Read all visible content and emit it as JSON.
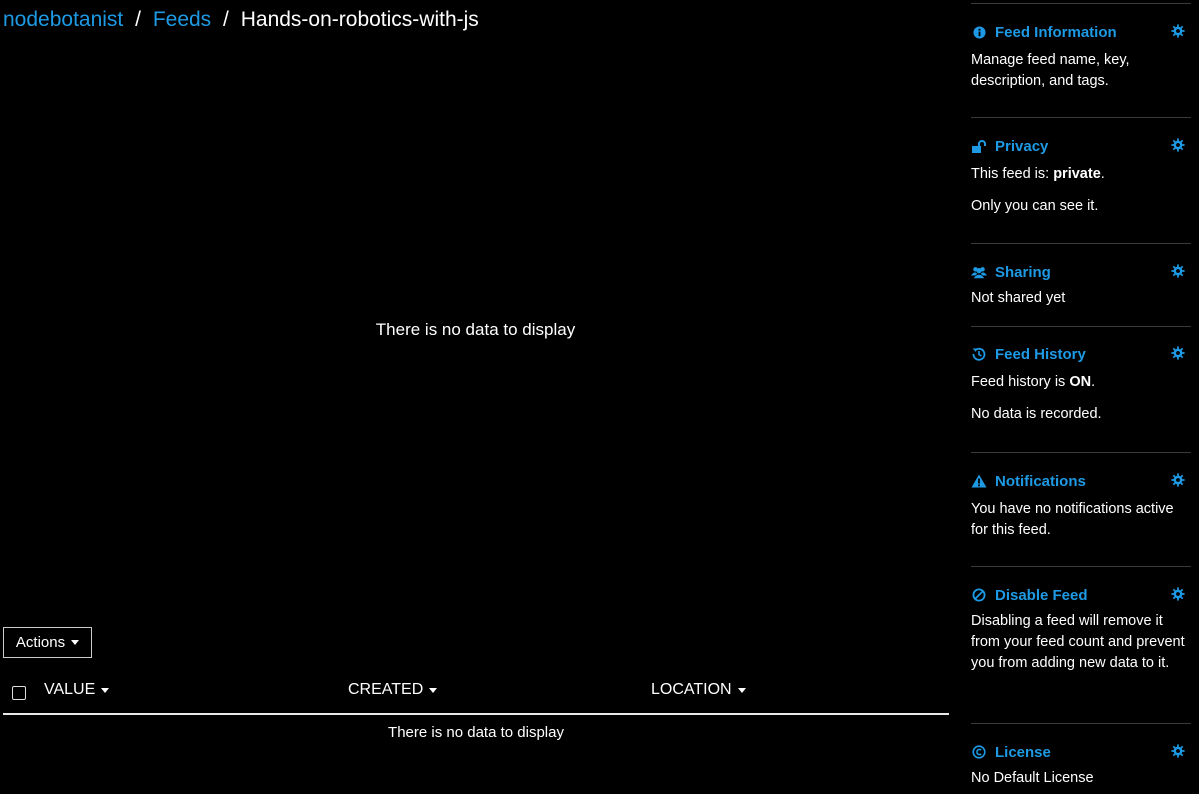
{
  "breadcrumb": {
    "user": "nodebotanist",
    "separator": "/",
    "feeds": "Feeds",
    "current": "Hands-on-robotics-with-js"
  },
  "chart": {
    "empty_text": "There is no data to display"
  },
  "actions": {
    "label": "Actions"
  },
  "table": {
    "columns": [
      "VALUE",
      "CREATED",
      "LOCATION"
    ],
    "empty_text": "There is no data to display"
  },
  "sidebar": {
    "feed_info": {
      "title": "Feed Information",
      "body": "Manage feed name, key, description, and tags."
    },
    "privacy": {
      "title": "Privacy",
      "line1_prefix": "This feed is: ",
      "line1_value": "private",
      "line1_suffix": ".",
      "line2": "Only you can see it."
    },
    "sharing": {
      "title": "Sharing",
      "body": "Not shared yet"
    },
    "history": {
      "title": "Feed History",
      "line1_prefix": "Feed history is ",
      "line1_value": "ON",
      "line1_suffix": ".",
      "line2": "No data is recorded."
    },
    "notifications": {
      "title": "Notifications",
      "body": "You have no notifications active for this feed."
    },
    "disable": {
      "title": "Disable Feed",
      "body": "Disabling a feed will remove it from your feed count and prevent you from adding new data to it."
    },
    "license": {
      "title": "License",
      "body": "No Default License"
    }
  },
  "colors": {
    "accent": "#1e9ae5",
    "background": "#000000",
    "text": "#ffffff"
  },
  "icons": {
    "feed_info": "info-circle-icon",
    "privacy": "unlock-icon",
    "sharing": "users-icon",
    "history": "history-icon",
    "notifications": "warning-icon",
    "disable": "ban-icon",
    "license": "copyright-icon",
    "settings": "gear-icon"
  }
}
